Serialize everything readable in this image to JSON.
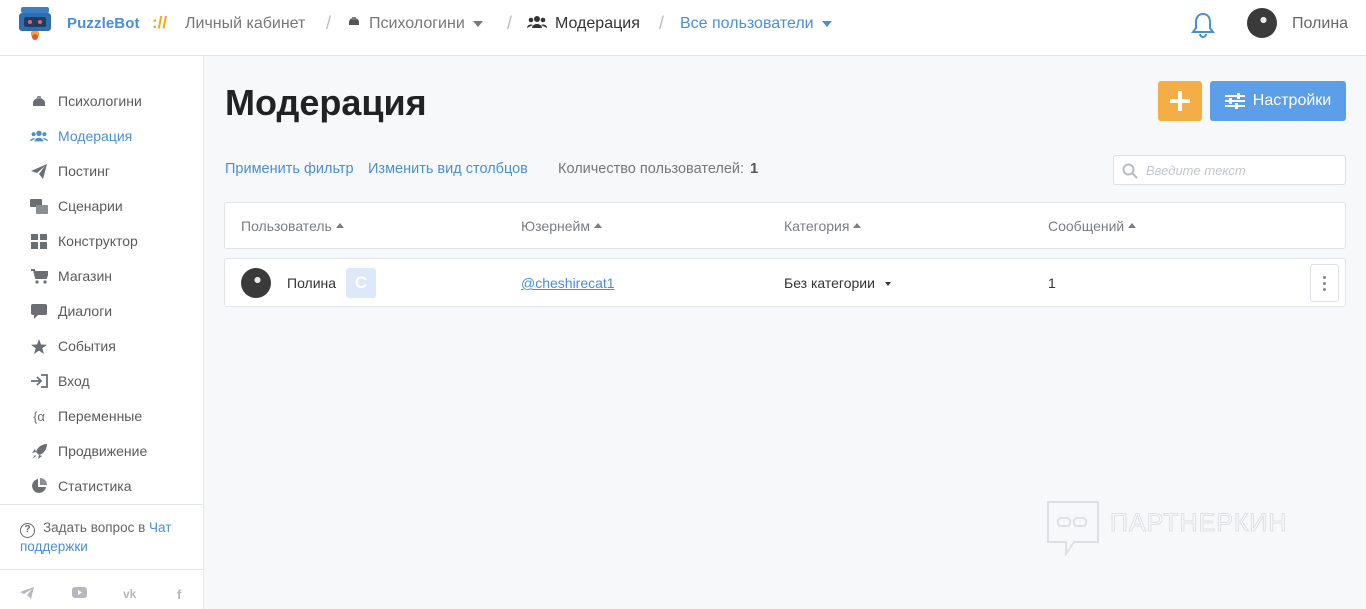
{
  "brand": {
    "name": "PuzzleBot",
    "slash": "://"
  },
  "breadcrumb": {
    "account": "Личный кабинет",
    "bot": "Психологини",
    "section": "Модерация",
    "filter": "Все пользователи"
  },
  "user": {
    "name": "Полина"
  },
  "sidebar": {
    "items": [
      {
        "label": "Психологини",
        "icon": "bot-icon"
      },
      {
        "label": "Модерация",
        "icon": "users-icon",
        "active": true
      },
      {
        "label": "Постинг",
        "icon": "paper-plane-icon"
      },
      {
        "label": "Сценарии",
        "icon": "scenarios-icon"
      },
      {
        "label": "Конструктор",
        "icon": "grid-icon"
      },
      {
        "label": "Магазин",
        "icon": "cart-icon"
      },
      {
        "label": "Диалоги",
        "icon": "chat-icon"
      },
      {
        "label": "События",
        "icon": "star-icon"
      },
      {
        "label": "Вход",
        "icon": "sign-in-icon"
      },
      {
        "label": "Переменные",
        "icon": "variable-icon"
      },
      {
        "label": "Продвижение",
        "icon": "rocket-icon"
      },
      {
        "label": "Статистика",
        "icon": "pie-chart-icon"
      }
    ],
    "help_prefix": "Задать вопрос в",
    "help_link": "Чат поддержки",
    "social": [
      "telegram-icon",
      "youtube-icon",
      "vk-icon",
      "facebook-icon"
    ]
  },
  "main": {
    "title": "Модерация",
    "add_label": "+",
    "settings_label": "Настройки",
    "apply_filter": "Применить фильтр",
    "change_columns": "Изменить вид столбцов",
    "count_label": "Количество пользователей:",
    "count_value": "1",
    "search_placeholder": "Введите текст",
    "columns": [
      "Пользователь",
      "Юзернейм",
      "Категория",
      "Сообщений"
    ],
    "rows": [
      {
        "name": "Полина",
        "badge": "C",
        "username": "@cheshirecat1",
        "category": "Без категории",
        "messages": "1"
      }
    ]
  },
  "watermark": "ПАРТНЕРКИН",
  "colors": {
    "accent": "#4a8fd3",
    "add_button": "#f5ad45",
    "settings_button": "#5c9ee8"
  }
}
